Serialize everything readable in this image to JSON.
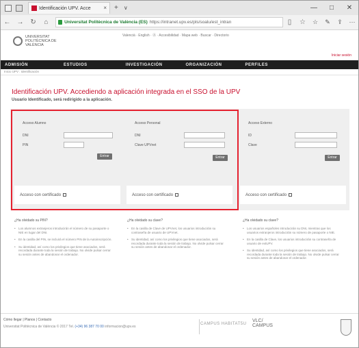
{
  "browser": {
    "tab_title": "Identificación UPV. Acce",
    "tab_close": "×",
    "new_tab": "+",
    "tab_dropdown": "∨",
    "win_minimize": "—",
    "win_maximize": "□",
    "win_close": "✕",
    "nav_back": "←",
    "nav_forward": "→",
    "nav_refresh": "↻",
    "nav_home": "⌂",
    "url_site": "Universitat Politècnica de València (ES)",
    "url_path": "https://intranet.upv.es/pls/soalu/est_intran",
    "reading_view": "▯",
    "favorite": "☆",
    "hub": "☆",
    "notes": "✎",
    "share": "⇪",
    "more": "···"
  },
  "site": {
    "logo_text": "UNIVERSITAT POLITÈCNICA DE VALÈNCIA",
    "top_links": "Valencià · English · Ⓐ · Accesibilidad · Mapa web · Buscar · Directorio",
    "login_link": "Iniciar sesión",
    "nav": [
      "ADMISIÓN",
      "ESTUDIOS",
      "INVESTIGACIÓN",
      "ORGANIZACIÓN",
      "PERFILES"
    ],
    "breadcrumb": "Inicio UPV  :  Identificación",
    "title": "Identificación UPV. Accediendo a aplicación integrada en el SSO de la UPV",
    "subtitle": "Usuario Identificado, será redirigido a la aplicación."
  },
  "panels": {
    "alumno": {
      "title": "Acceso Alumno",
      "label1": "DNI",
      "label2": "PIN",
      "submit": "Entrar",
      "cert": "Acceso con certificado"
    },
    "personal": {
      "title": "Acceso Personal",
      "label1": "DNI",
      "label2": "Clave UPVnet",
      "submit": "Entrar",
      "cert": "Acceso con certificado"
    },
    "externo": {
      "title": "Acceso Externo",
      "label1": "ID",
      "label2": "Clave",
      "submit": "Entrar",
      "cert": "Acceso con certificado"
    }
  },
  "help": {
    "col1": {
      "question": "¿Ha olvidado su PIN?",
      "items": [
        "Los alumnos extranjeros introducirán el número de su pasaporte o NIE en lugar del DNI.",
        "En la casilla del PIN, se incluirá el número PIN de la Autoinscripción.",
        "Su identidad, así como los privilegios que tiene asociados, será recordada durante toda la sesión de trabajo. No olvide pulsar cerrar su sesión antes de abandonar el ordenador."
      ]
    },
    "col2": {
      "question": "¿Ha olvidado su clave?",
      "items": [
        "En la casilla de Clave de UPVnet, los usuarios introducirán su contraseña de usuario de UPVnet.",
        "Su identidad, así como los privilegios que tiene asociados, será recordada durante toda la sesión de trabajo. No olvide pulsar cerrar su sesión antes de abandonar el ordenador."
      ]
    },
    "col3": {
      "question": "¿Ha olvidado su clave?",
      "items": [
        "Los usuarios españoles introducirán su DNI, mientras que los usuarios extranjeros introducirán su número de pasaporte o NIE.",
        "En la casilla de Clave, los usuarios introducirán su contraseña de usuario de extUPV.",
        "Su identidad, así como los privilegios que tiene asociados, será recordada durante toda la sesión de trabajo. No olvide pulsar cerrar su sesión antes de abandonar el ordenador."
      ]
    }
  },
  "footer": {
    "links": "Cómo llegar  |  Planos  |  Contacto",
    "org": "Universitat Politècnica de València © 2017",
    "tel_label": "Tel.",
    "tel": "(+34) 96 387 70 00",
    "email": "informacion@upv.es",
    "campus1": "CAMPUS HABITAT5U",
    "campus2_a": "VLC/",
    "campus2_b": "CAMPUS"
  }
}
